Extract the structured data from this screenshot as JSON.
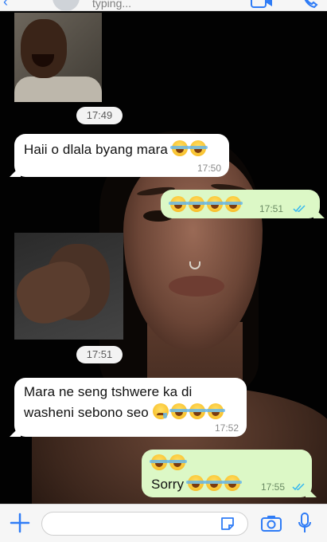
{
  "header": {
    "status": "typing..."
  },
  "messages": [
    {
      "id": "m1",
      "type": "photo",
      "time": "17:49",
      "direction": "in"
    },
    {
      "id": "m2",
      "type": "text",
      "direction": "in",
      "text": "Haii o dlala byang mara",
      "emojis": [
        "joy",
        "joy"
      ],
      "time": "17:50"
    },
    {
      "id": "m3",
      "type": "text",
      "direction": "out",
      "emojis": [
        "joy",
        "joy",
        "joy",
        "joy"
      ],
      "time": "17:51",
      "read": true
    },
    {
      "id": "m4",
      "type": "photo",
      "time": "17:51",
      "direction": "in"
    },
    {
      "id": "m5",
      "type": "text",
      "direction": "in",
      "line1": "Mara ne seng tshwere ka di",
      "line2": "washeni sebono seo",
      "emojis": [
        "crying",
        "joy",
        "joy",
        "joy"
      ],
      "time": "17:52"
    },
    {
      "id": "m6",
      "type": "text",
      "direction": "out",
      "emojis_top": [
        "joy",
        "joy"
      ],
      "text": "Sorry",
      "emojis": [
        "joy",
        "joy",
        "rofl"
      ],
      "time": "17:55",
      "read": true
    }
  ],
  "colors": {
    "incoming_bubble": "#ffffff",
    "outgoing_bubble": "#dcf8c6",
    "accent": "#2f7cf6",
    "read_ticks": "#34b7f1"
  },
  "icons": [
    "back-arrow-icon",
    "avatar-icon",
    "video-call-icon",
    "phone-icon",
    "plus-icon",
    "sticker-icon",
    "camera-icon",
    "mic-icon"
  ]
}
